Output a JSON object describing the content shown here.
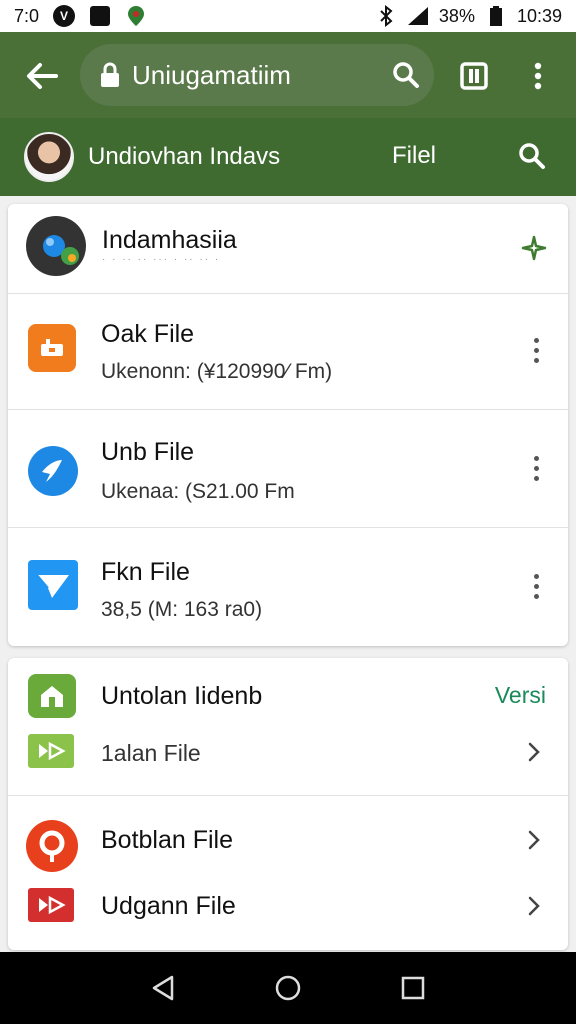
{
  "status_bar": {
    "time": "7:0",
    "battery": "38%",
    "clock": "10:39"
  },
  "browser": {
    "url_title": "Uniugamatiim",
    "icons": [
      "back-arrow-icon",
      "lock-icon",
      "search-icon",
      "tabs-icon",
      "more-vert-icon"
    ]
  },
  "subheader": {
    "title": "Undiovhan Indavs",
    "file_label": "Filel"
  },
  "list_card": {
    "header": {
      "title": "Indamhasiia",
      "subtitle": "· · ·· ·· ··· · ·· ·· ·"
    },
    "files": [
      {
        "name": "Oak File",
        "detail": "Ukenonn: (¥120990∕ Fm)",
        "icon": "orange-file-icon",
        "color": "#f07c1e"
      },
      {
        "name": "Unb File",
        "detail": "Ukenaa: (S21.00 Fm",
        "icon": "blue-circle-icon",
        "color": "#1e88e5"
      },
      {
        "name": "Fkn File",
        "detail": "38,5 (M: 163 ra0)",
        "icon": "mail-icon",
        "color": "#2196f3"
      }
    ]
  },
  "section_card": {
    "header": {
      "title": "Untolan Iidenb",
      "action": "Versi"
    },
    "items": [
      {
        "name": "1alan File",
        "icon": "green-play-icon",
        "color": "#8bc34a"
      },
      {
        "name": "Botblan File",
        "icon": "red-location-icon",
        "color": "#e8401c"
      },
      {
        "name": "Udgann File",
        "icon": "red-play-icon",
        "color": "#d32f2f"
      }
    ]
  }
}
